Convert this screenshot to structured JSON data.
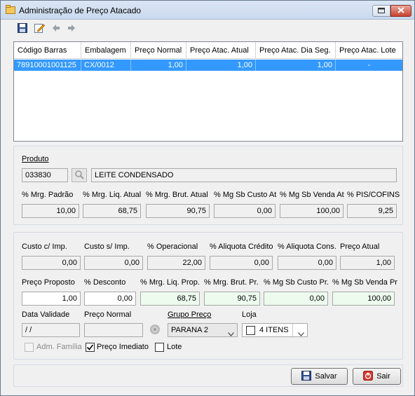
{
  "window": {
    "title": "Administração de Preço Atacado"
  },
  "grid": {
    "columns": [
      "Código Barras",
      "Embalagem",
      "Preço Normal",
      "Preço Atac. Atual",
      "Preço Atac. Dia Seg.",
      "Preço Atac. Lote"
    ],
    "rows": [
      [
        "78910001001125",
        "CX/0012",
        "1,00",
        "1,00",
        "1,00",
        "-"
      ]
    ]
  },
  "produto": {
    "label": "Produto",
    "code": "033830",
    "description": "LEITE CONDENSADO"
  },
  "margins": {
    "labels": [
      "% Mrg. Padrão",
      "% Mrg. Liq. Atual",
      "% Mrg. Brut. Atual",
      "% Mg Sb Custo At",
      "% Mg Sb Venda At",
      "% PIS/COFINS"
    ],
    "values": [
      "10,00",
      "68,75",
      "90,75",
      "0,00",
      "100,00",
      "9,25"
    ]
  },
  "costs": {
    "labels": [
      "Custo c/ Imp.",
      "Custo s/ Imp.",
      "% Operacional",
      "% Aliquota Crédito",
      "% Aliquota Cons.",
      "Preço Atual"
    ],
    "values": [
      "0,00",
      "0,00",
      "22,00",
      "0,00",
      "0,00",
      "1,00"
    ]
  },
  "proposal": {
    "labels": [
      "Preço Proposto",
      "% Desconto",
      "% Mrg. Liq. Prop.",
      "% Mrg. Brut. Pr.",
      "% Mg Sb Custo Pr.",
      "% Mg Sb Venda Pr"
    ],
    "values": [
      "1,00",
      "0,00",
      "68,75",
      "90,75",
      "0,00",
      "100,00"
    ]
  },
  "bottom": {
    "data_validade_label": "Data Validade",
    "data_validade_value": " / /",
    "preco_normal_label": "Preço Normal",
    "preco_normal_value": "",
    "grupo_preco_label": "Grupo Preço",
    "grupo_preco_value": "PARANA 2",
    "loja_label": "Loja",
    "loja_value": "4 ITENS"
  },
  "checks": {
    "adm_familia": {
      "label": "Adm. Família",
      "checked": false,
      "enabled": false
    },
    "preco_imediato": {
      "label": "Preço Imediato",
      "checked": true,
      "enabled": true
    },
    "lote": {
      "label": "Lote",
      "checked": false,
      "enabled": true
    }
  },
  "buttons": {
    "salvar": "Salvar",
    "sair": "Sair"
  },
  "colors": {
    "selection": "#3399ff",
    "green_field": "#ecfbee",
    "title_bg": "#c9d9ee"
  },
  "icons": [
    "app-icon",
    "save-icon",
    "edit-icon",
    "back-arrow-icon",
    "forward-arrow-icon",
    "search-icon",
    "gear-icon",
    "restore-icon",
    "close-icon",
    "chevron-down-icon",
    "disk-icon",
    "power-icon"
  ]
}
